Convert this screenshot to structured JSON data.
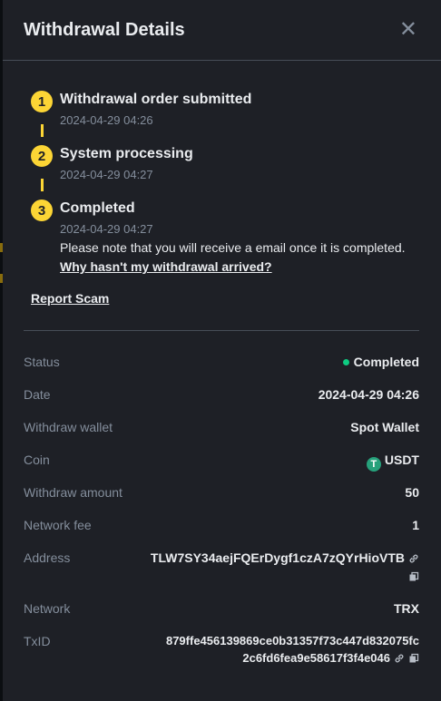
{
  "header": {
    "title": "Withdrawal Details",
    "close_icon": "close-icon"
  },
  "steps": [
    {
      "num": "1",
      "title": "Withdrawal order submitted",
      "time": "2024-04-29 04:26"
    },
    {
      "num": "2",
      "title": "System processing",
      "time": "2024-04-29 04:27"
    },
    {
      "num": "3",
      "title": "Completed",
      "time": "2024-04-29 04:27"
    }
  ],
  "note": "Please note that you will receive a email once it is completed.",
  "why_link": "Why hasn't my withdrawal arrived?",
  "report_link": "Report Scam",
  "details": {
    "status": {
      "label": "Status",
      "value": "Completed",
      "color": "#0ecb81"
    },
    "date": {
      "label": "Date",
      "value": "2024-04-29 04:26"
    },
    "wallet": {
      "label": "Withdraw wallet",
      "value": "Spot Wallet"
    },
    "coin": {
      "label": "Coin",
      "value": "USDT",
      "icon_glyph": "T"
    },
    "amount": {
      "label": "Withdraw amount",
      "value": "50"
    },
    "fee": {
      "label": "Network fee",
      "value": "1"
    },
    "address": {
      "label": "Address",
      "value": "TLW7SY34aejFQErDygf1czA7zQYrHioVTB"
    },
    "network": {
      "label": "Network",
      "value": "TRX"
    },
    "txid": {
      "label": "TxID",
      "line1": "879ffe456139869ce0b31357f73c447d832075fc",
      "line2": "2c6fd6fea9e58617f3f4e046"
    }
  },
  "colors": {
    "accent": "#fcd535",
    "background": "#1e2026",
    "muted": "#848e9c"
  }
}
